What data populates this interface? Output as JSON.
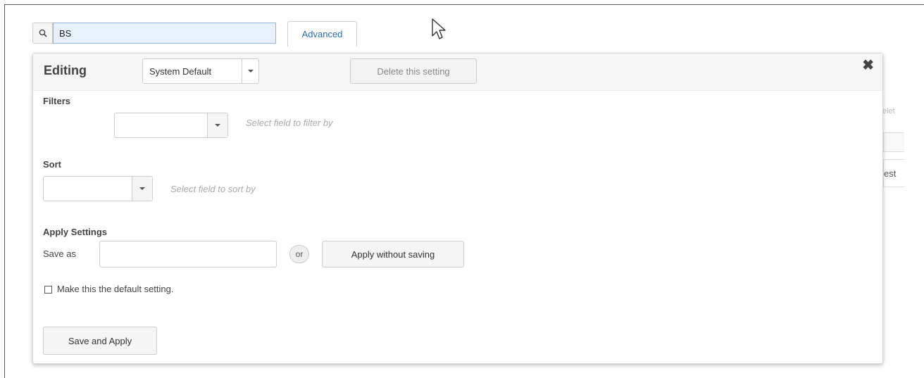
{
  "search": {
    "value": "BS",
    "icon": "search-icon"
  },
  "advanced_tab": {
    "label": "Advanced"
  },
  "panel": {
    "title": "Editing",
    "setting_select": {
      "value": "System Default"
    },
    "delete_label": "Delete this setting",
    "close_icon": "close-icon",
    "filters": {
      "label": "Filters",
      "hint": "Select field to filter by"
    },
    "sort": {
      "label": "Sort",
      "hint": "Select field to sort by"
    },
    "apply": {
      "label": "Apply Settings",
      "save_as_label": "Save as",
      "or_label": "or",
      "apply_without_saving_label": "Apply without saving",
      "default_checkbox_label": "Make this the default setting.",
      "default_checked": false,
      "save_and_apply_label": "Save and Apply"
    }
  },
  "background": {
    "fragment_1": "elet",
    "fragment_2": "est"
  }
}
